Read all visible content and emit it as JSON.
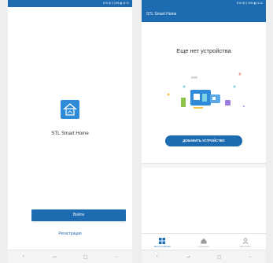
{
  "colors": {
    "accent": "#1d6bb0",
    "logo_bg": "#2f8ad8",
    "navbar_bg": "#f4f4f4",
    "text": "#333333"
  },
  "left": {
    "status_text": "8 ✉ ⚙ ▯ 10% ▮ 11:11",
    "app_name": "STL Smart Home",
    "login_label": "Войти",
    "register_label": "Регистрация"
  },
  "right": {
    "status_text": "8 ✉ ⚙ ▯ 10% ▮ 11:11",
    "appbar_title": "STL Smart Home",
    "empty_title": "Еще нет устройства",
    "add_device_label": "ДОБАВИТЬ УСТРОЙСТВО",
    "tabs": [
      {
        "label": "Мои устройства",
        "icon": "grid-icon",
        "active": true
      },
      {
        "label": "Сценарии",
        "icon": "home-icon",
        "active": false
      },
      {
        "label": "Настройки",
        "icon": "person-icon",
        "active": false
      }
    ]
  },
  "navbar_icons": [
    "dot-icon",
    "recent-apps-icon",
    "home-square-icon",
    "back-arrow-icon"
  ]
}
